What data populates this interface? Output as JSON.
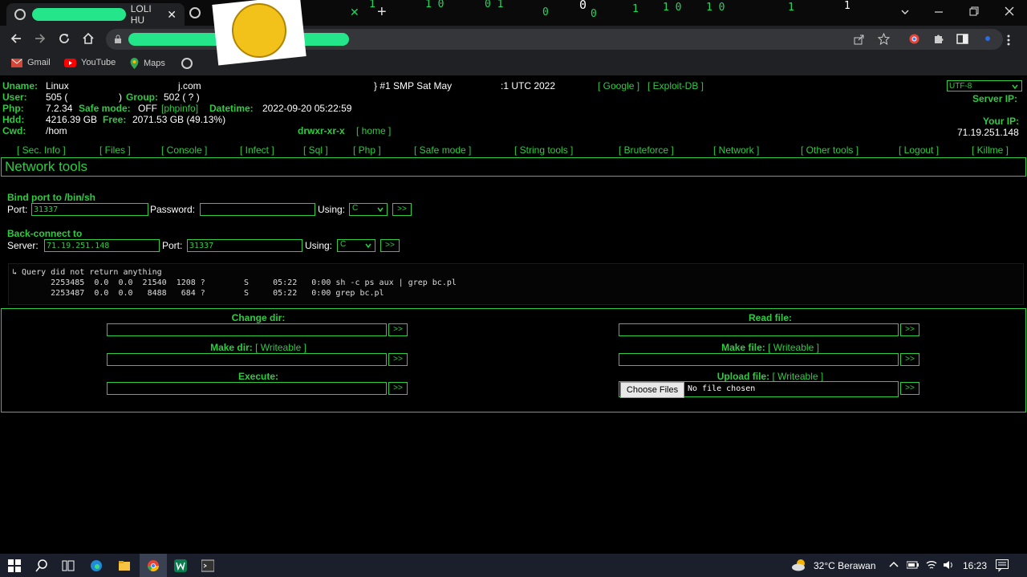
{
  "browser": {
    "tab1_title": "LOLI HU",
    "close_glyph": "✕",
    "new_tab": "+",
    "bookmarks": [
      {
        "label": "Gmail",
        "icon": "gmail-icon",
        "color": "#d44638"
      },
      {
        "label": "YouTube",
        "icon": "youtube-icon",
        "color": "#ff0000"
      },
      {
        "label": "Maps",
        "icon": "maps-icon",
        "color": "#34a853"
      }
    ],
    "matrix_digits": [
      "1",
      "1 0",
      "0 1",
      "0",
      "0",
      "0",
      "1",
      "1 0",
      "1 0",
      "1 0",
      "1",
      "1"
    ]
  },
  "shell": {
    "info": {
      "uname_label": "Uname:",
      "uname_value": "Linux",
      "uname_host_tail": "j.com",
      "uname_kernel": "} #1 SMP Sat May",
      "uname_tail": ":1 UTC 2022",
      "google_link": "[ Google ]",
      "exploit_link": "[ Exploit-DB ]",
      "user_label": "User:",
      "user_value": "505 (",
      "user_close": ")",
      "group_label": "Group:",
      "group_value": "502 ( ? )",
      "php_label": "Php:",
      "php_value": "7.2.34",
      "safe_label": "Safe mode:",
      "safe_value": "OFF",
      "phpinfo_link": "[phpinfo]",
      "datetime_label": "Datetime:",
      "datetime_value": "2022-09-20 05:22:59",
      "hdd_label": "Hdd:",
      "hdd_value": "4216.39 GB",
      "free_label": "Free:",
      "free_value": "2071.53 GB (49.13%)",
      "cwd_label": "Cwd:",
      "cwd_value": "/hom",
      "perms": "drwxr-xr-x",
      "home_link": "[ home ]",
      "charset": "UTF-8",
      "server_ip_label": "Server IP:",
      "your_ip_label": "Your IP:",
      "your_ip_value": "71.19.251.148"
    },
    "nav": [
      "[ Sec. Info ]",
      "[ Files ]",
      "[ Console ]",
      "[ Infect ]",
      "[ Sql ]",
      "[ Php ]",
      "[ Safe mode ]",
      "[ String tools ]",
      "[ Bruteforce ]",
      "[ Network ]",
      "[ Other tools ]",
      "[ Logout ]",
      "[ Killme ]"
    ],
    "section_title": "Network tools",
    "bind": {
      "title": "Bind port to /bin/sh",
      "port_label": "Port:",
      "port_value": "31337",
      "password_label": "Password:",
      "password_value": "",
      "using_label": "Using:",
      "using_value": "C",
      "go": ">>"
    },
    "backconnect": {
      "title": "Back-connect to",
      "server_label": "Server:",
      "server_value": "71.19.251.148",
      "port_label": "Port:",
      "port_value": "31337",
      "using_label": "Using:",
      "using_value": "C",
      "go": ">>"
    },
    "output": {
      "line1": "↳ Query did not return anything",
      "line2": "        2253485  0.0  0.0  21540  1208 ?        S     05:22   0:00 sh -c ps aux | grep bc.pl",
      "line3": "        2253487  0.0  0.0   8488   684 ?        S     05:22   0:00 grep bc.pl"
    },
    "forms": {
      "change_dir": "Change dir:",
      "make_dir": "Make dir:",
      "make_dir_link": "[ Writeable ]",
      "execute": "Execute:",
      "read_file": "Read file:",
      "make_file": "Make file:",
      "make_file_link": "[ Writeable ]",
      "upload_file": "Upload file:",
      "upload_link": "[ Writeable ]",
      "choose_files": "Choose Files",
      "no_file": "No file chosen",
      "go": ">>"
    }
  },
  "taskbar": {
    "weather": "32°C Berawan",
    "time": "16:23",
    "up_arrow": "^"
  },
  "colors": {
    "accent": "#2ecc40",
    "background": "#000000",
    "redaction": "#25e58a"
  }
}
